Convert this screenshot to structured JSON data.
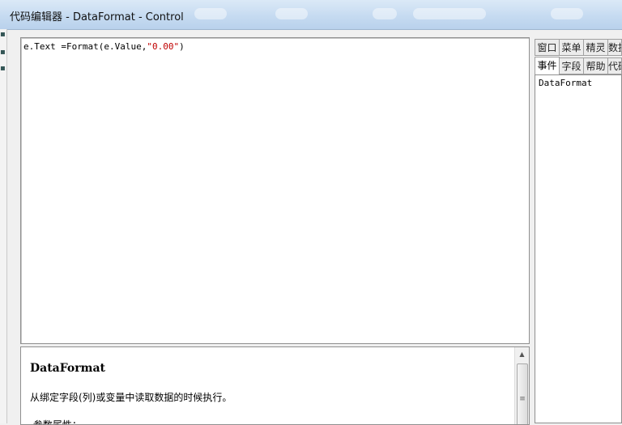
{
  "window": {
    "title": "代码编辑器 - DataFormat - Control"
  },
  "editor": {
    "code_prefix": "e.Text =Format(e.Value,",
    "code_string": "\"0.00\"",
    "code_suffix": ")"
  },
  "help": {
    "title": "DataFormat",
    "description": "从绑定字段(列)或变量中读取数据的时候执行。",
    "subheading": "·参数属性："
  },
  "side_panel": {
    "tabs_row1": [
      "窗口",
      "菜单",
      "精灵",
      "数据"
    ],
    "tabs_row2": [
      "事件",
      "字段",
      "帮助",
      "代码"
    ],
    "active_tab": "事件",
    "list_items": [
      "DataFormat"
    ]
  },
  "icons": {
    "scroll_up": "arrow-up-icon",
    "scroll_grip": "grip-icon"
  },
  "colors": {
    "string_literal": "#c00000",
    "titlebar": "#c6dbf1"
  }
}
